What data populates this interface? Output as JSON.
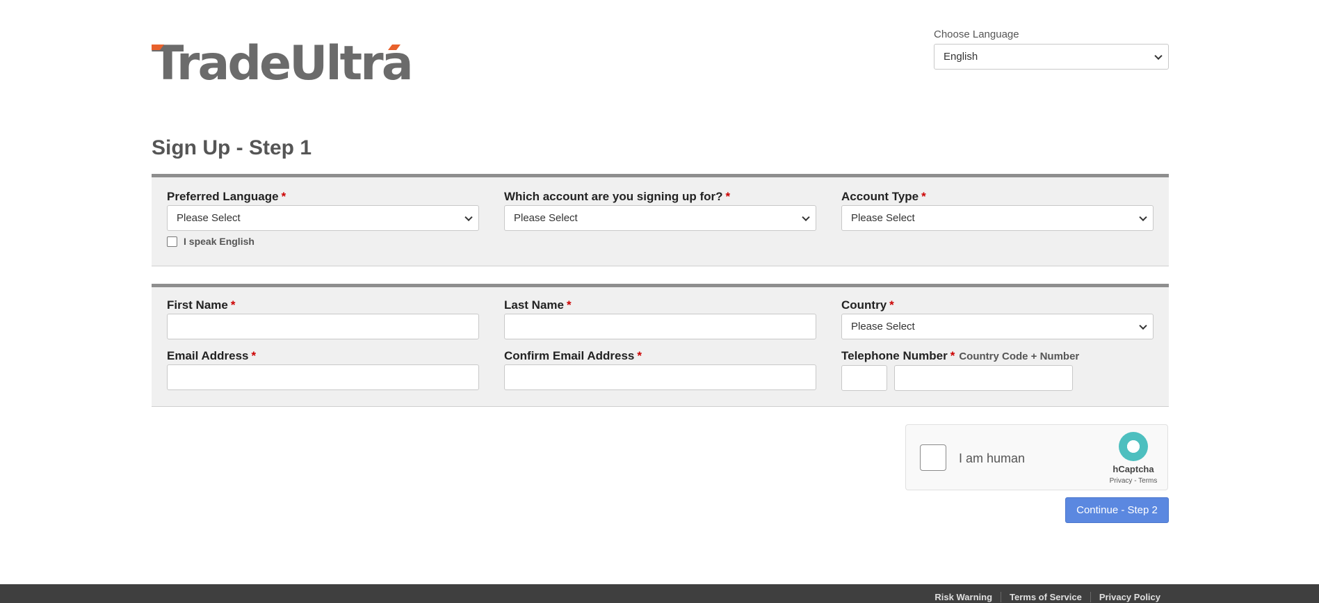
{
  "header": {
    "logo_text": "TradeUltra",
    "choose_language_label": "Choose Language",
    "language_value": "English"
  },
  "page": {
    "title": "Sign Up - Step 1"
  },
  "section1": {
    "preferred_language": {
      "label": "Preferred Language",
      "value": "Please Select"
    },
    "account_signup": {
      "label": "Which account are you signing up for?",
      "value": "Please Select"
    },
    "account_type": {
      "label": "Account Type",
      "value": "Please Select"
    },
    "speak_english_label": "I speak English"
  },
  "section2": {
    "first_name": {
      "label": "First Name",
      "value": ""
    },
    "last_name": {
      "label": "Last Name",
      "value": ""
    },
    "country": {
      "label": "Country",
      "value": "Please Select"
    },
    "email": {
      "label": "Email Address",
      "value": ""
    },
    "confirm_email": {
      "label": "Confirm Email Address",
      "value": ""
    },
    "telephone": {
      "label": "Telephone Number",
      "hint": "Country Code + Number",
      "code": "",
      "number": ""
    }
  },
  "required_marker": "*",
  "captcha": {
    "label": "I am human",
    "brand": "hCaptcha",
    "links": "Privacy - Terms"
  },
  "actions": {
    "continue_label": "Continue - Step 2"
  },
  "footer": {
    "links": [
      "Risk Warning",
      "Terms of Service",
      "Privacy Policy"
    ]
  },
  "colors": {
    "primary_button": "#5b88e0",
    "required": "#cc0000",
    "footer_bg": "#3f3f3f",
    "logo_gray": "#6b6b6b",
    "logo_accent": "#e8612c",
    "captcha_teal": "#4dbfbf"
  }
}
